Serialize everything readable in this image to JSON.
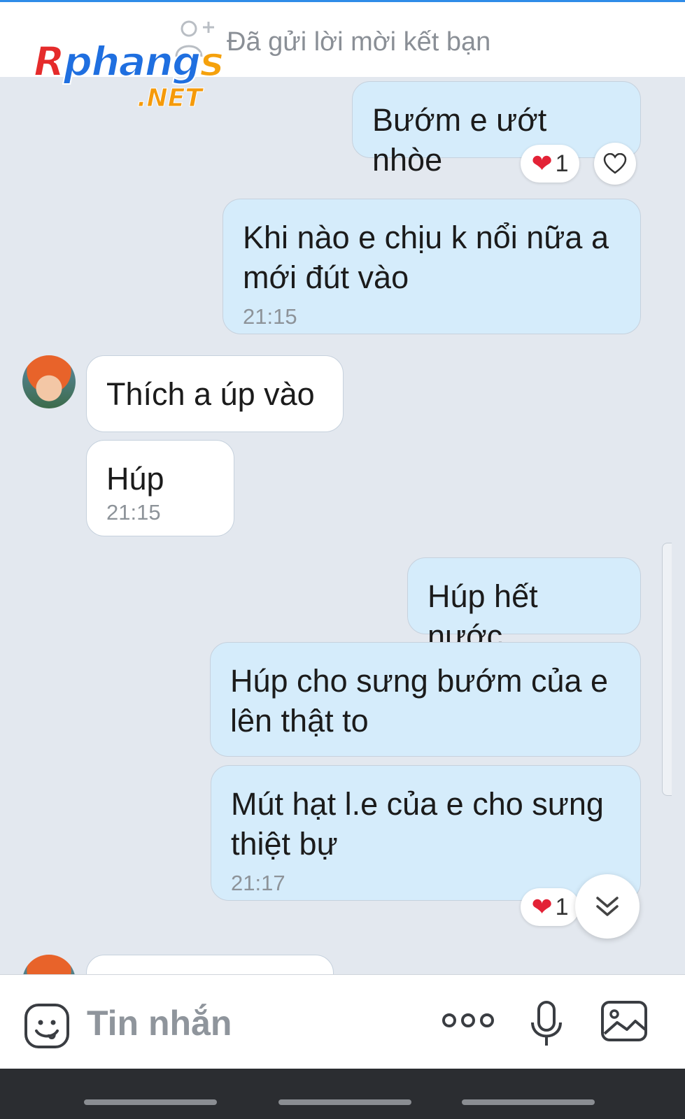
{
  "header": {
    "friend_status": "Đã gửi lời mời kết bạn"
  },
  "watermark": {
    "main_r": "R",
    "main_mid": "phang",
    "main_s": "s",
    "sub": ".NET"
  },
  "messages": [
    {
      "from": "me",
      "text": "Bướm e ướt nhòe",
      "reaction_count": "1"
    },
    {
      "from": "me",
      "text_line1": "Khi nào e chịu k nổi nữa a",
      "text_line2": "mới đút vào",
      "time": "21:15"
    },
    {
      "from": "them",
      "text": "Thích a úp vào"
    },
    {
      "from": "them",
      "text": "Húp",
      "time": "21:15"
    },
    {
      "from": "me",
      "text": "Húp hết nước"
    },
    {
      "from": "me",
      "text_line1": "Húp cho sưng bướm của e",
      "text_line2": "lên thật to"
    },
    {
      "from": "me",
      "text_line1": "Mút hạt l.e của e cho sưng",
      "text_line2": "thiệt bự",
      "time": "21:17",
      "reaction_count": "1"
    }
  ],
  "composer": {
    "placeholder": "Tin nhắn"
  },
  "colors": {
    "background": "#e3e8ef",
    "my_bubble": "#d5ecfb",
    "their_bubble": "#ffffff",
    "accent": "#2f8ce8",
    "heart": "#e32236"
  }
}
